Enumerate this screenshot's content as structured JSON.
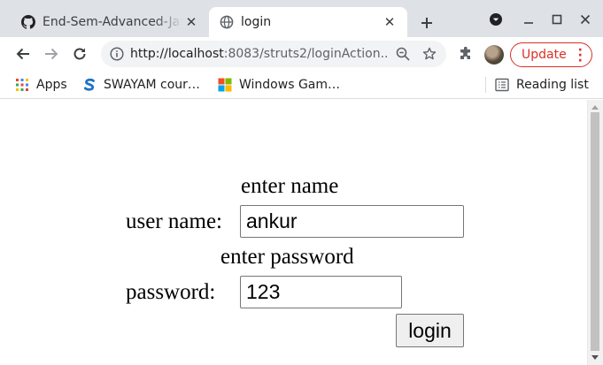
{
  "tabs": [
    {
      "title": "End-Sem-Advanced-Java",
      "icon": "github-icon",
      "active": false
    },
    {
      "title": "login",
      "icon": "globe-icon",
      "active": true
    }
  ],
  "toolbar": {
    "url_host": "http://localhost",
    "url_rest": ":8083/struts2/loginAction....",
    "update_label": "Update",
    "update_color": "#d93025"
  },
  "bookmarks": [
    {
      "label": "Apps",
      "icon": "apps-grid-icon"
    },
    {
      "label": "SWAYAM cour…",
      "icon": "swayam-icon"
    },
    {
      "label": "Windows Gam…",
      "icon": "windows-logo-icon"
    }
  ],
  "reading_list": {
    "label": "Reading list",
    "icon": "reading-list-icon"
  },
  "form": {
    "name_hint": "enter name",
    "name_label": "user name:",
    "name_value": "ankur",
    "password_hint": "enter password",
    "password_label": "password:",
    "password_value": "123",
    "submit_label": "login"
  }
}
